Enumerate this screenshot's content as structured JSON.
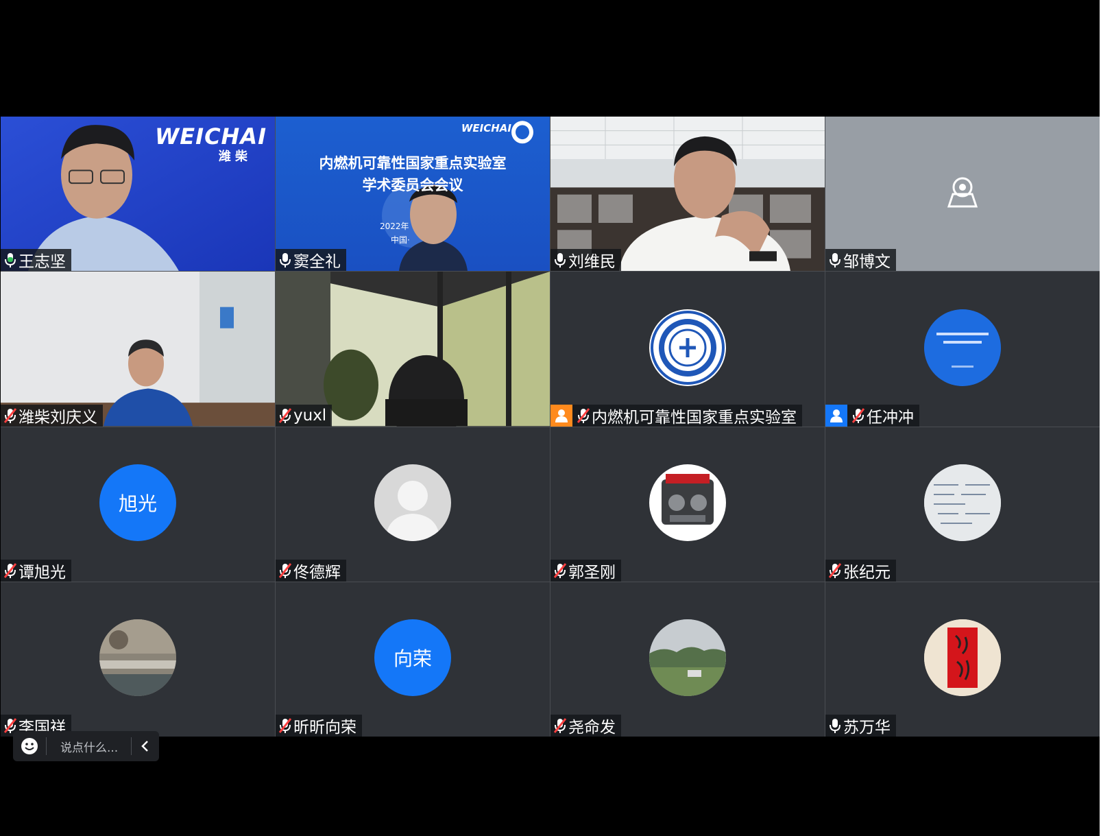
{
  "participants": [
    {
      "name": "王志坚",
      "mic": "speaking",
      "active": true
    },
    {
      "name": "窦全礼",
      "mic": "on"
    },
    {
      "name": "刘维民",
      "mic": "on"
    },
    {
      "name": "邹博文",
      "mic": "on"
    },
    {
      "name": "潍柴刘庆义",
      "mic": "muted"
    },
    {
      "name": "yuxl",
      "mic": "muted"
    },
    {
      "name": "内燃机可靠性国家重点实验室",
      "mic": "muted",
      "role": "host",
      "role_color": "#ff8a1d"
    },
    {
      "name": "任冲冲",
      "mic": "muted",
      "role": "cohost",
      "role_color": "#1477f8"
    },
    {
      "name": "谭旭光",
      "mic": "muted",
      "initials": "旭光"
    },
    {
      "name": "佟德辉",
      "mic": "muted"
    },
    {
      "name": "郭圣刚",
      "mic": "muted"
    },
    {
      "name": "张纪元",
      "mic": "muted"
    },
    {
      "name": "李国祥",
      "mic": "muted"
    },
    {
      "name": "昕昕向荣",
      "mic": "muted",
      "initials": "向荣"
    },
    {
      "name": "尧命发",
      "mic": "muted"
    },
    {
      "name": "苏万华",
      "mic": "on"
    }
  ],
  "banner": {
    "brand": "WEICHAI",
    "brand_cn": "潍 柴",
    "title_line1": "内燃机可靠性国家重点实验室",
    "title_line2": "学术委员会会议",
    "date_partial": "2022年",
    "place_partial": "中国·"
  },
  "chat": {
    "placeholder": "说点什么..."
  },
  "colors": {
    "speaking": "#33c05a",
    "muted": "#ff4040",
    "accent": "#1477f8"
  }
}
